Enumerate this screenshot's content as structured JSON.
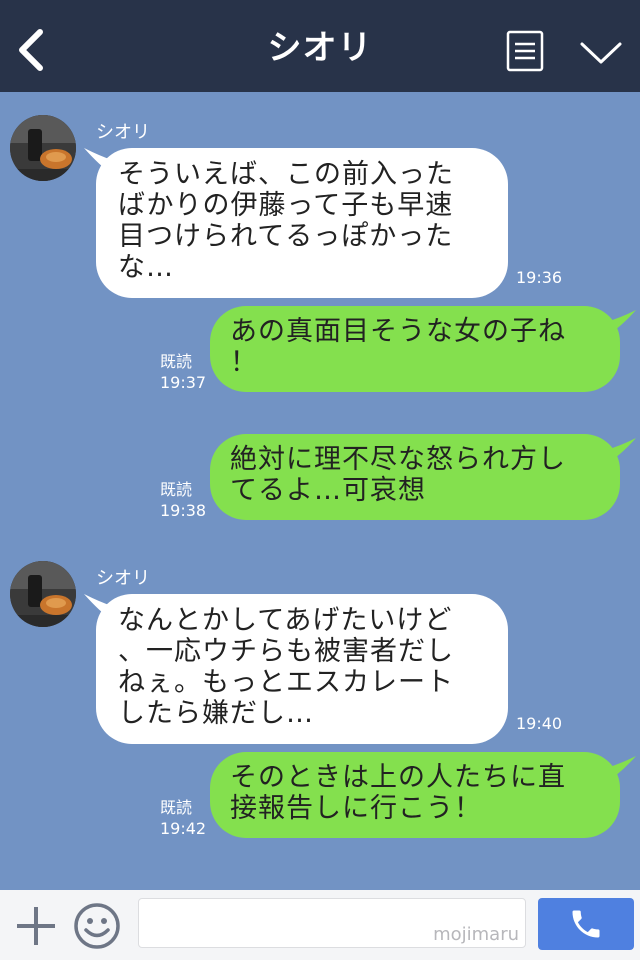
{
  "header": {
    "title": "シオリ"
  },
  "messages": [
    {
      "sender": "シオリ",
      "lines": [
        "そういえば、この前入った",
        "ばかりの伊藤って子も早速",
        "目つけられてるっぽかった",
        "な…"
      ],
      "time": "19:36"
    },
    {
      "lines": [
        "あの真面目そうな女の子ね",
        "！"
      ],
      "read": "既読",
      "time": "19:37"
    },
    {
      "lines": [
        "絶対に理不尽な怒られ方し",
        "てるよ…可哀想"
      ],
      "read": "既読",
      "time": "19:38"
    },
    {
      "sender": "シオリ",
      "lines": [
        "なんとかしてあげたいけど",
        "、一応ウチらも被害者だし",
        "ねぇ。もっとエスカレート",
        "したら嫌だし…"
      ],
      "time": "19:40"
    },
    {
      "lines": [
        "そのときは上の人たちに直",
        "接報告しに行こう！"
      ],
      "read": "既読",
      "time": "19:42"
    }
  ],
  "footer": {
    "watermark": "mojimaru"
  },
  "colors": {
    "header_bg": "#283349",
    "chat_bg": "#7293c4",
    "incoming_bubble": "#ffffff",
    "outgoing_bubble": "#84e04e",
    "call_button": "#4f80e0"
  },
  "icons": {
    "back": "chevron-left-icon",
    "menu": "list-icon",
    "collapse": "chevron-down-icon",
    "plus": "plus-icon",
    "emoji": "smiley-icon",
    "call": "phone-icon"
  }
}
